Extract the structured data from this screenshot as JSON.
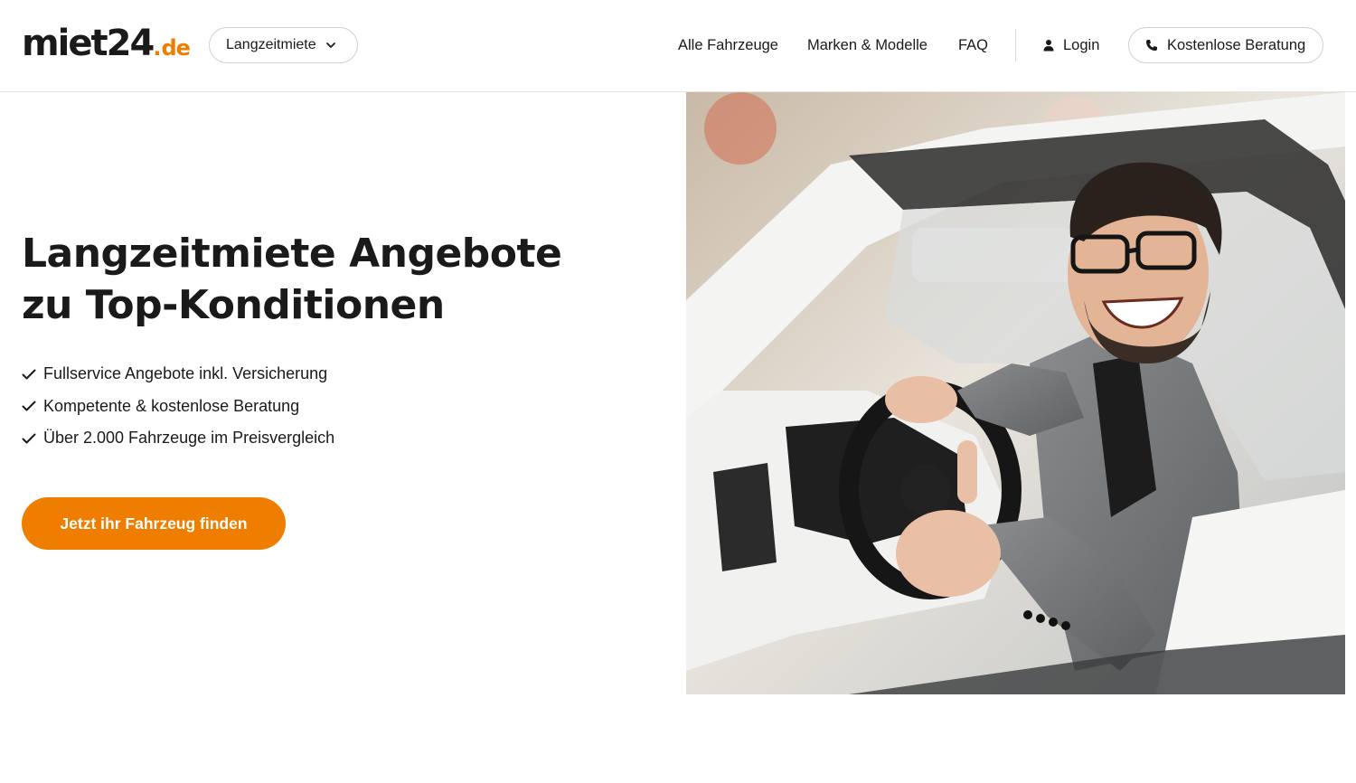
{
  "brand": {
    "logo_main": "miet24",
    "logo_dot": ".",
    "logo_suffix": "de",
    "accent_color": "#ef7d00"
  },
  "header": {
    "category_select": {
      "value": "Langzeitmiete",
      "icon": "chevron-down-icon"
    },
    "nav": [
      "Alle Fahrzeuge",
      "Marken & Modelle",
      "FAQ"
    ],
    "login": {
      "label": "Login",
      "icon": "user-icon"
    },
    "consult_button": {
      "label": "Kostenlose Beratung",
      "icon": "phone-icon"
    }
  },
  "hero": {
    "title_line1": "Langzeitmiete Angebote",
    "title_line2": "zu Top-Konditionen",
    "features": [
      "Fullservice Angebote inkl. Versicherung",
      "Kompetente & kostenlose Beratung",
      "Über 2.000 Fahrzeuge im Preisvergleich"
    ],
    "feature_icon": "check-icon",
    "cta_label": "Jetzt ihr Fahrzeug finden"
  },
  "image": {
    "description_name": "hero-photo-man-in-car",
    "button_color": "#ef7d00"
  }
}
